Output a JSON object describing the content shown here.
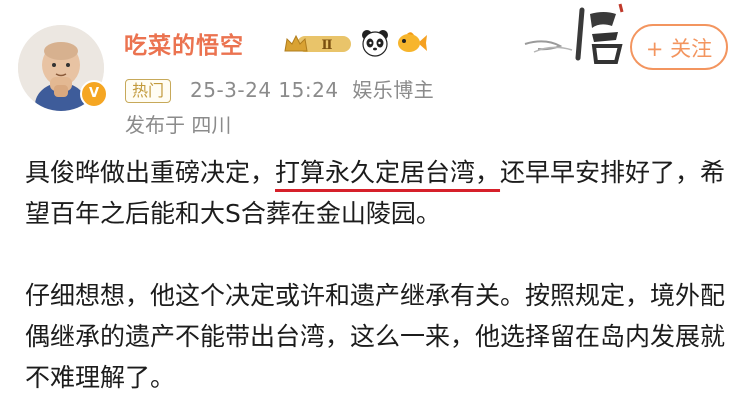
{
  "user": {
    "name": "吃菜的悟空",
    "level": "Ⅱ",
    "verified_mark": "V"
  },
  "follow_button": "+ 关注",
  "meta": {
    "tag": "热门",
    "time": "25-3-24 15:24",
    "category": "娱乐博主",
    "location": "发布于 四川"
  },
  "post": {
    "p1_before": "具俊晔做出重磅决定，",
    "p1_highlight": "打算永久定居台湾，",
    "p1_after": "还早早安排好了，希望百年之后能和大S合葬在金山陵园。",
    "p2": "仔细想想，他这个决定或许和遗产继承有关。按照规定，境外配偶继承的遗产不能带出台湾，这么一来，他选择留在岛内发展就不难理解了。"
  },
  "icons": {
    "avatar": "monk-avatar",
    "level": "crown-level-badge-icon",
    "emoji1": "panda-icon",
    "emoji2": "goldfish-icon",
    "logo": "wukong-calligraphy-logo"
  },
  "colors": {
    "username": "#eb7350",
    "follow": "#f3955f",
    "underline": "#d6202a",
    "meta": "#8b8b8b"
  }
}
